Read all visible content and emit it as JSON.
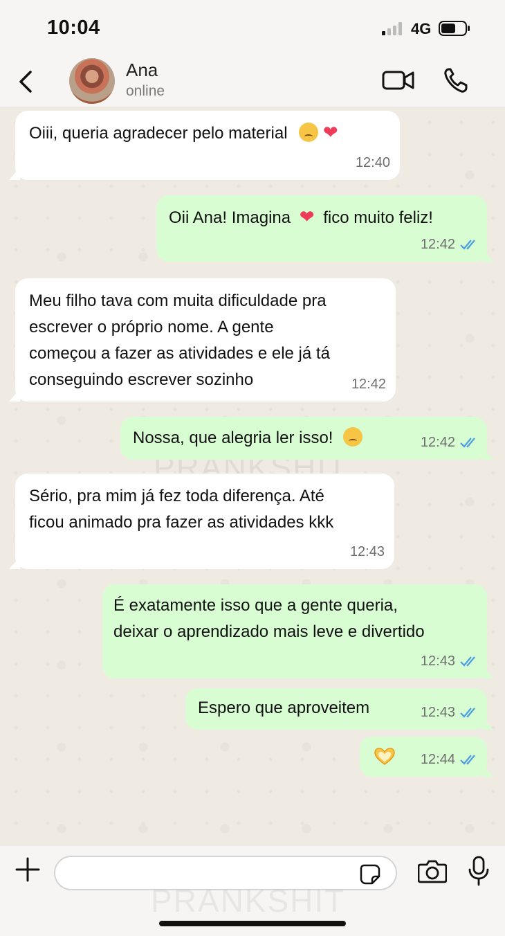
{
  "status_bar": {
    "time": "10:04",
    "network": "4G",
    "icons": [
      "signal-icon",
      "battery-icon"
    ]
  },
  "header": {
    "name": "Ana",
    "status": "online",
    "icons": [
      "back-icon",
      "video-call-icon",
      "voice-call-icon"
    ]
  },
  "messages": [
    {
      "dir": "in",
      "text_lines": [
        "Oiii, queria agradecer pelo material"
      ],
      "emoji": [
        "pleading-face",
        "red-heart"
      ],
      "time": "12:40"
    },
    {
      "dir": "out",
      "text_lines": [
        "Oii Ana! Imagina",
        "fico muito feliz!"
      ],
      "emoji": [
        "red-heart"
      ],
      "time": "12:42",
      "read": true
    },
    {
      "dir": "in",
      "text_lines": [
        "Meu filho tava com muita dificuldade pra",
        "escrever o próprio nome. A gente",
        "começou a fazer as atividades e ele já tá",
        "conseguindo escrever sozinho"
      ],
      "time": "12:42"
    },
    {
      "dir": "out",
      "text_lines": [
        "Nossa, que alegria ler isso!"
      ],
      "emoji": [
        "pleading-face"
      ],
      "time": "12:42",
      "read": true
    },
    {
      "dir": "in",
      "text_lines": [
        "Sério, pra mim já fez toda diferença. Até",
        "ficou animado pra fazer as atividades kkk"
      ],
      "time": "12:43"
    },
    {
      "dir": "out",
      "text_lines": [
        "É exatamente isso que a gente queria,",
        "deixar o aprendizado mais leve e divertido"
      ],
      "time": "12:43",
      "read": true
    },
    {
      "dir": "out",
      "text_lines": [
        "Espero que aproveitem"
      ],
      "time": "12:43",
      "read": true
    },
    {
      "dir": "out",
      "text_lines": [],
      "emoji": [
        "heart-hands"
      ],
      "time": "12:44",
      "read": true
    }
  ],
  "colors": {
    "incoming": "#ffffff",
    "outgoing": "#d9fdd3",
    "read_ticks": "#4a9de0",
    "background": "#efeae2"
  },
  "watermark": "PRANKSHIT",
  "composer": {
    "value": "",
    "icons": [
      "plus-icon",
      "sticker-icon",
      "camera-icon",
      "mic-icon"
    ]
  }
}
